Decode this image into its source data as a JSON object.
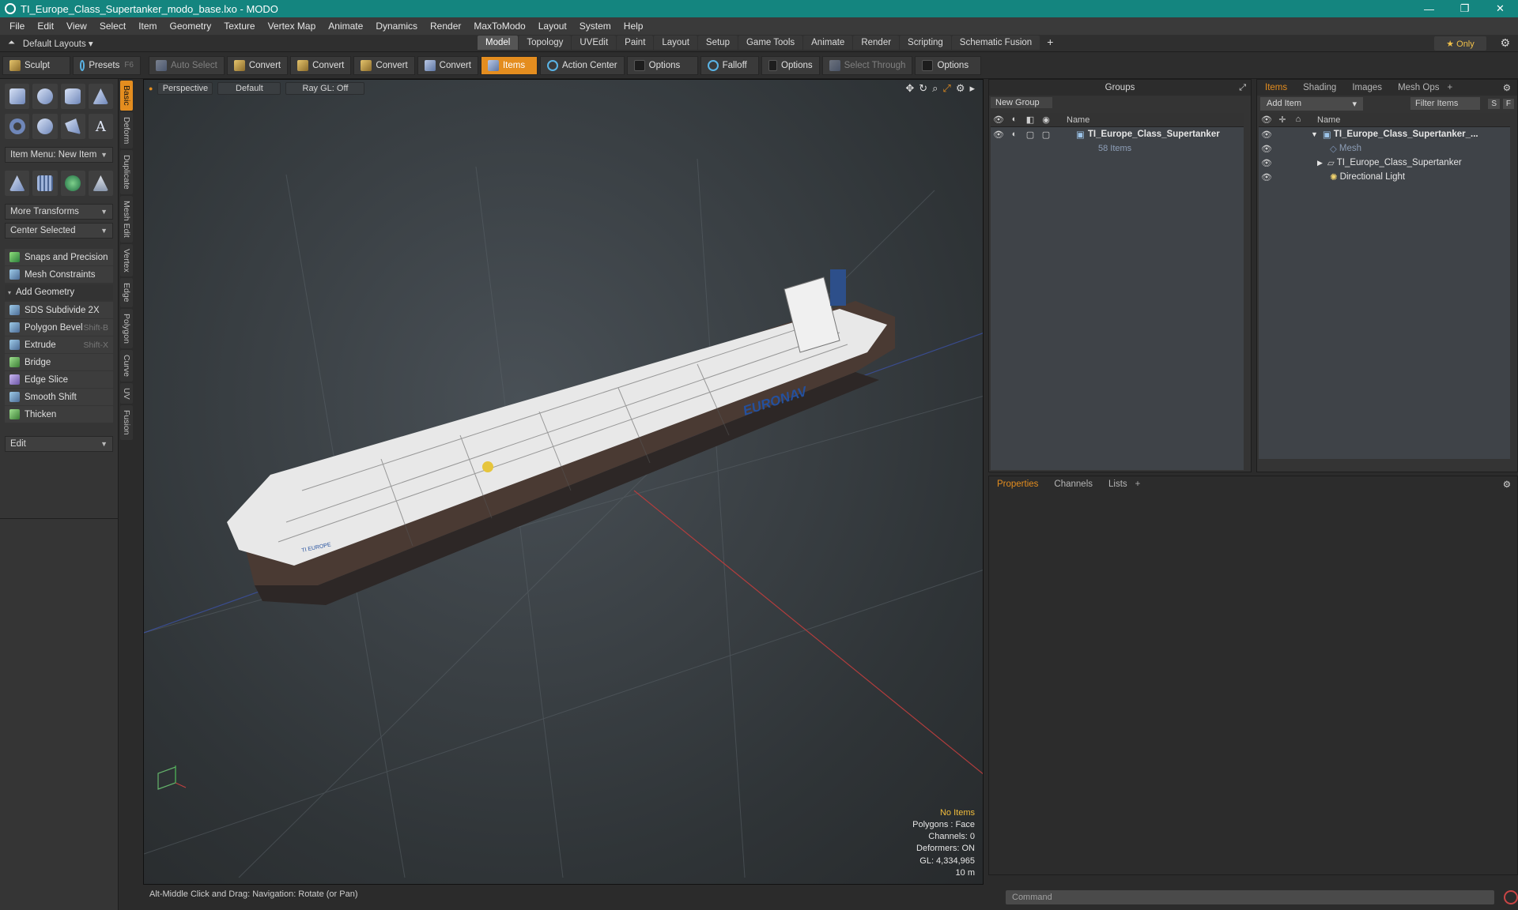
{
  "window": {
    "title": "TI_Europe_Class_Supertanker_modo_base.lxo - MODO",
    "controls": [
      "—",
      "❐",
      "✕"
    ]
  },
  "menu": [
    "File",
    "Edit",
    "View",
    "Select",
    "Item",
    "Geometry",
    "Texture",
    "Vertex Map",
    "Animate",
    "Dynamics",
    "Render",
    "MaxToModo",
    "Layout",
    "System",
    "Help"
  ],
  "layoutbar": {
    "layouts_label": "Default Layouts",
    "tabs": [
      "Model",
      "Topology",
      "UVEdit",
      "Paint",
      "Layout",
      "Setup",
      "Game Tools",
      "Animate",
      "Render",
      "Scripting",
      "Schematic Fusion"
    ],
    "active_tab": "Model",
    "only_label": "★  Only"
  },
  "toolbar": {
    "sculpt": "Sculpt",
    "presets": "Presets",
    "presets_key": "F6",
    "auto_select": "Auto Select",
    "convert1": "Convert",
    "convert2": "Convert",
    "convert3": "Convert",
    "convert4": "Convert",
    "items": "Items",
    "action_center": "Action Center",
    "options1": "Options",
    "falloff": "Falloff",
    "options2": "Options",
    "select_through": "Select Through",
    "options3": "Options"
  },
  "leftpanel": {
    "item_menu": "Item Menu: New Item",
    "more_transforms": "More Transforms",
    "center_selected": "Center Selected",
    "snaps": "Snaps and Precision",
    "mesh_constraints": "Mesh Constraints",
    "add_geometry": "Add Geometry",
    "tools": [
      {
        "label": "SDS Subdivide 2X",
        "key": ""
      },
      {
        "label": "Polygon Bevel",
        "key": "Shift-B"
      },
      {
        "label": "Extrude",
        "key": "Shift-X"
      },
      {
        "label": "Bridge",
        "key": ""
      },
      {
        "label": "Edge Slice",
        "key": ""
      },
      {
        "label": "Smooth Shift",
        "key": ""
      },
      {
        "label": "Thicken",
        "key": ""
      }
    ],
    "edit": "Edit",
    "vtabs": [
      "Basic",
      "Deform",
      "Duplicate",
      "Mesh Edit",
      "Vertex",
      "Edge",
      "Polygon",
      "Curve",
      "UV",
      "Fusion"
    ]
  },
  "viewport": {
    "view": "Perspective",
    "shading": "Default",
    "raygl": "Ray GL: Off",
    "hull_text": "EURONAV",
    "stern_text": "TI EUROPE",
    "info": {
      "selection": "No Items",
      "polygons": "Polygons : Face",
      "channels": "Channels: 0",
      "deformers": "Deformers: ON",
      "gl": "GL: 4,334,965",
      "scale": "10 m"
    }
  },
  "status": {
    "hint": "Alt-Middle Click and Drag:   Navigation: Rotate (or Pan)"
  },
  "groups": {
    "title": "Groups",
    "new_group": "New Group",
    "name_col": "Name",
    "group_name": "TI_Europe_Class_Supertanker",
    "group_count": "58 Items"
  },
  "items": {
    "tabs": [
      "Items",
      "Shading",
      "Images",
      "Mesh Ops"
    ],
    "add_item": "Add Item",
    "filter": "Filter Items",
    "s": "S",
    "f": "F",
    "name_col": "Name",
    "tree": [
      {
        "label": "TI_Europe_Class_Supertanker_...",
        "indent": 0
      },
      {
        "label": "Mesh",
        "indent": 1
      },
      {
        "label": "TI_Europe_Class_Supertanker",
        "indent": 1
      },
      {
        "label": "Directional Light",
        "indent": 1
      }
    ]
  },
  "properties": {
    "tabs": [
      "Properties",
      "Channels",
      "Lists"
    ]
  },
  "command": {
    "placeholder": "Command"
  },
  "colors": {
    "accent": "#e48d1f",
    "titlebar": "#14857f",
    "info_highlight": "#f2bd3d"
  }
}
